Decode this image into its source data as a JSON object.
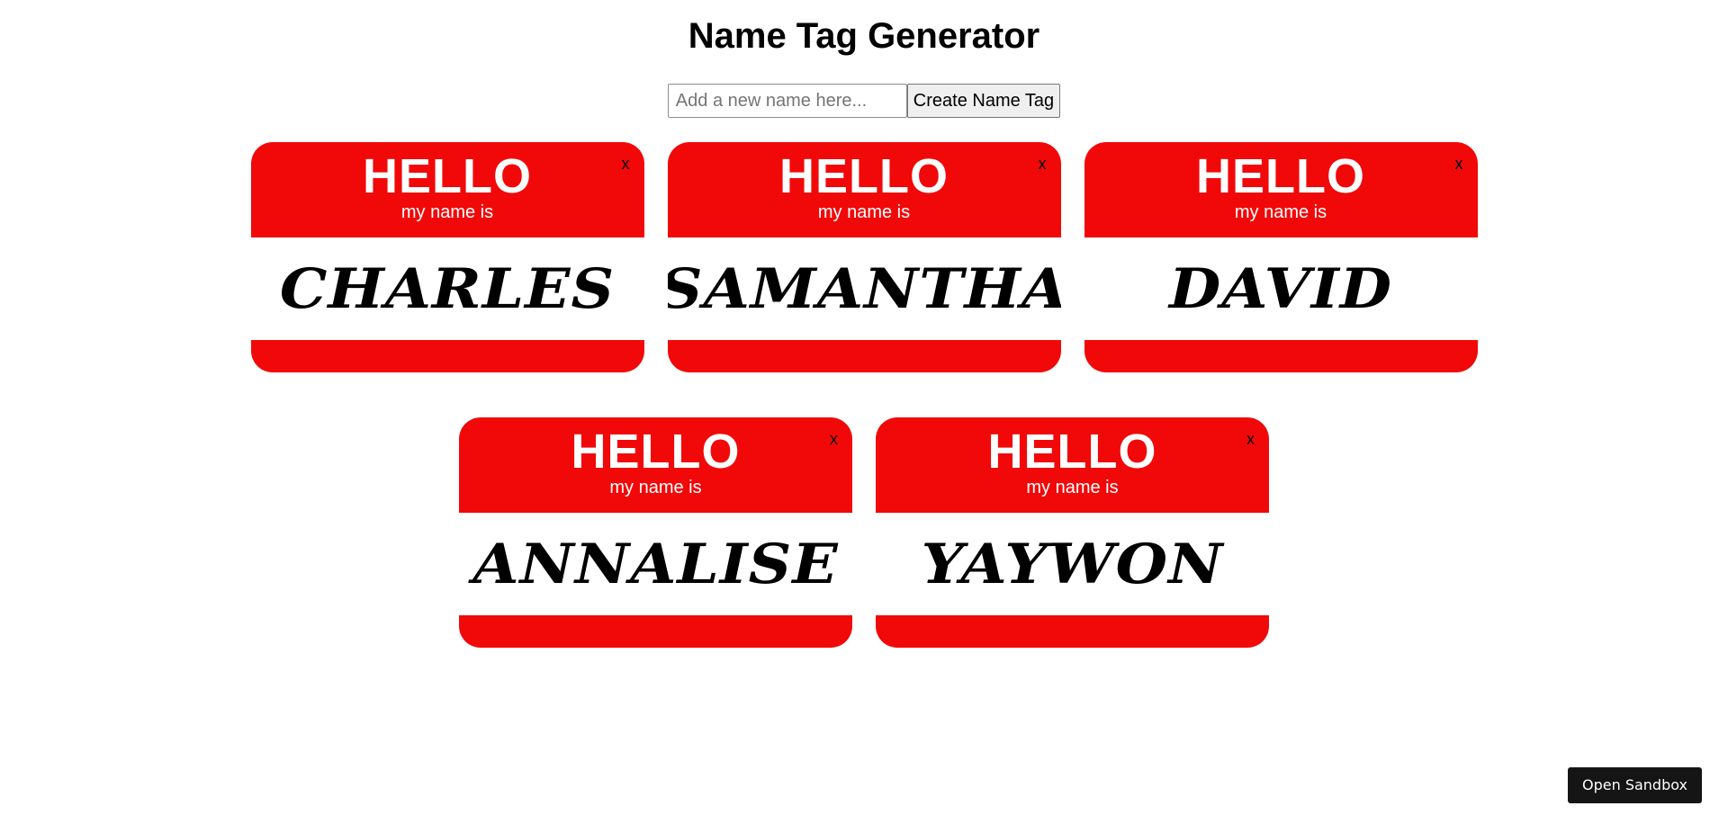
{
  "header": {
    "title": "Name Tag Generator"
  },
  "form": {
    "input_value": "",
    "input_placeholder": "Add a new name here...",
    "create_label": "Create Name Tag"
  },
  "tags": [
    {
      "hello": "HELLO",
      "subtitle": "my name is",
      "close": "x",
      "name": "Charles"
    },
    {
      "hello": "HELLO",
      "subtitle": "my name is",
      "close": "x",
      "name": "Samantha"
    },
    {
      "hello": "HELLO",
      "subtitle": "my name is",
      "close": "x",
      "name": "David"
    },
    {
      "hello": "HELLO",
      "subtitle": "my name is",
      "close": "x",
      "name": "Annalise"
    },
    {
      "hello": "HELLO",
      "subtitle": "my name is",
      "close": "x",
      "name": "Yaywon"
    }
  ],
  "footer": {
    "sandbox_label": "Open Sandbox"
  },
  "colors": {
    "tag_red": "#f10909",
    "sandbox_bg": "#151515"
  }
}
